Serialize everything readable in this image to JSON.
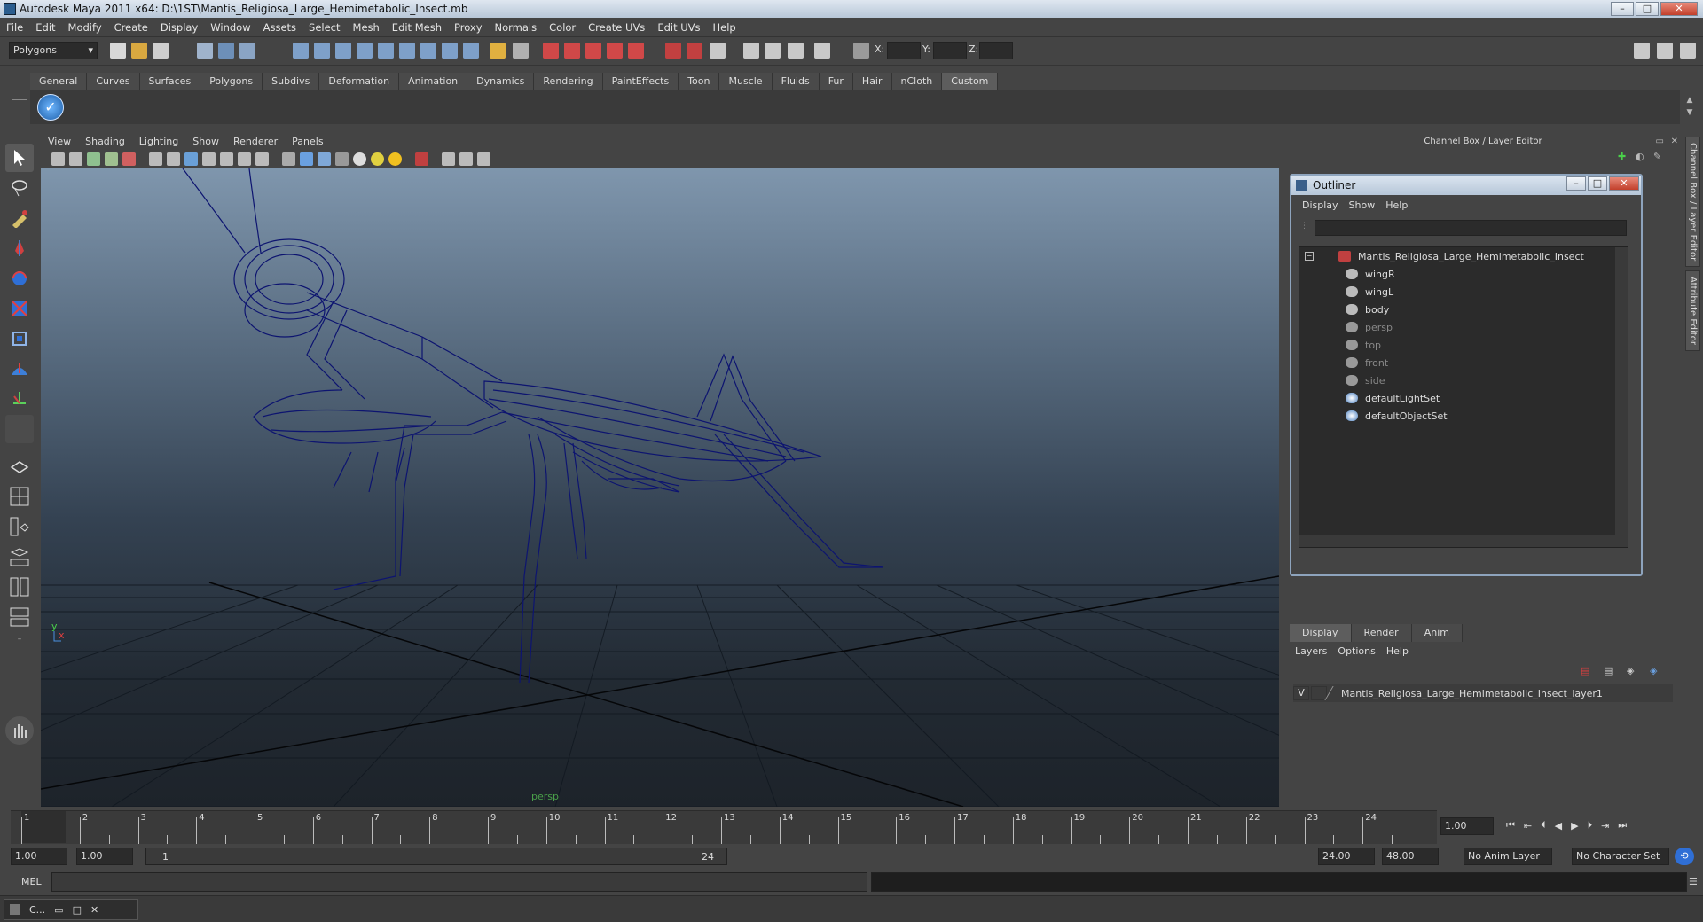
{
  "window": {
    "title": "Autodesk Maya 2011 x64: D:\\1ST\\Mantis_Religiosa_Large_Hemimetabolic_Insect.mb"
  },
  "menubar": [
    "File",
    "Edit",
    "Modify",
    "Create",
    "Display",
    "Window",
    "Assets",
    "Select",
    "Mesh",
    "Edit Mesh",
    "Proxy",
    "Normals",
    "Color",
    "Create UVs",
    "Edit UVs",
    "Help"
  ],
  "status_line": {
    "mode": "Polygons",
    "x_label": "X:",
    "y_label": "Y:",
    "z_label": "Z:"
  },
  "shelf_tabs": [
    "General",
    "Curves",
    "Surfaces",
    "Polygons",
    "Subdivs",
    "Deformation",
    "Animation",
    "Dynamics",
    "Rendering",
    "PaintEffects",
    "Toon",
    "Muscle",
    "Fluids",
    "Fur",
    "Hair",
    "nCloth",
    "Custom"
  ],
  "shelf_active": "Custom",
  "panel_menu": [
    "View",
    "Shading",
    "Lighting",
    "Show",
    "Renderer",
    "Panels"
  ],
  "viewport": {
    "camera_label": "persp",
    "axis_y": "y",
    "axis_x": "x"
  },
  "channel_box": {
    "header": "Channel Box / Layer Editor"
  },
  "side_tabs": [
    "Channel Box / Layer Editor",
    "Attribute Editor"
  ],
  "outliner": {
    "title": "Outliner",
    "menu": [
      "Display",
      "Show",
      "Help"
    ],
    "items": [
      {
        "label": "Mantis_Religiosa_Large_Hemimetabolic_Insect",
        "dim": false
      },
      {
        "label": "wingR",
        "dim": false
      },
      {
        "label": "wingL",
        "dim": false
      },
      {
        "label": "body",
        "dim": false
      },
      {
        "label": "persp",
        "dim": true
      },
      {
        "label": "top",
        "dim": true
      },
      {
        "label": "front",
        "dim": true
      },
      {
        "label": "side",
        "dim": true
      },
      {
        "label": "defaultLightSet",
        "dim": false
      },
      {
        "label": "defaultObjectSet",
        "dim": false
      }
    ]
  },
  "layer_editor": {
    "tabs": [
      "Display",
      "Render",
      "Anim"
    ],
    "active_tab": "Display",
    "menu": [
      "Layers",
      "Options",
      "Help"
    ],
    "layer_visibility": "V",
    "layer_name": "Mantis_Religiosa_Large_Hemimetabolic_Insect_layer1"
  },
  "time_slider": {
    "ticks": [
      1,
      2,
      3,
      4,
      5,
      6,
      7,
      8,
      9,
      10,
      11,
      12,
      13,
      14,
      15,
      16,
      17,
      18,
      19,
      20,
      21,
      22,
      23,
      24
    ],
    "current_frame": "1.00"
  },
  "range": {
    "start": "1.00",
    "anim_start": "1.00",
    "range_start": "1",
    "range_end": "24",
    "anim_end": "24.00",
    "end": "48.00",
    "anim_layer": "No Anim Layer",
    "character_set": "No Character Set"
  },
  "command_line": {
    "label": "MEL"
  },
  "taskbar": {
    "item": "C..."
  },
  "colors": {
    "wire": "#0d1470",
    "accent": "#5d5d5d",
    "title_grad": "#dbe5f0"
  }
}
